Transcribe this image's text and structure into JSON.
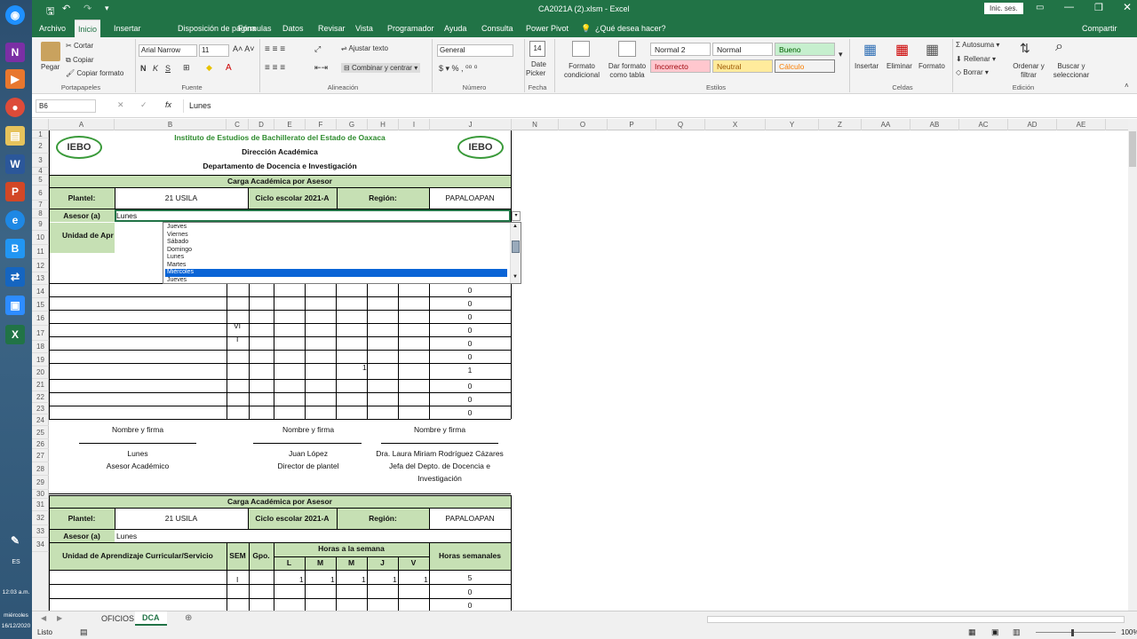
{
  "window": {
    "title": "CA2021A (2).xlsm  -  Excel",
    "signin": "Inic. ses.",
    "share": "Compartir"
  },
  "tabs": [
    "Archivo",
    "Inicio",
    "Insertar",
    "Disposición de página",
    "Fórmulas",
    "Datos",
    "Revisar",
    "Vista",
    "Programador",
    "Ayuda",
    "Consulta",
    "Power Pivot",
    "¿Qué desea hacer?"
  ],
  "ribbon": {
    "clipboard": {
      "paste": "Pegar",
      "cut": "Cortar",
      "copy": "Copiar",
      "format_painter": "Copiar formato",
      "label": "Portapapeles"
    },
    "font": {
      "name": "Arial Narrow",
      "size": "11",
      "label": "Fuente"
    },
    "alignment": {
      "wrap": "Ajustar texto",
      "merge": "Combinar y centrar",
      "label": "Alineación"
    },
    "number": {
      "format": "General",
      "label": "Número"
    },
    "date": {
      "btn1": "Date",
      "btn2": "Picker",
      "label": "Fecha"
    },
    "styles": {
      "cond": "Formato condicional",
      "table": "Dar formato como tabla",
      "normal2": "Normal 2",
      "normal": "Normal",
      "bueno": "Bueno",
      "incorrecto": "Incorrecto",
      "neutral": "Neutral",
      "calculo": "Cálculo",
      "label": "Estilos"
    },
    "cells": {
      "insert": "Insertar",
      "delete": "Eliminar",
      "format": "Formato",
      "label": "Celdas"
    },
    "editing": {
      "autosum": "Autosuma",
      "fill": "Rellenar",
      "clear": "Borrar",
      "sort": "Ordenar y filtrar",
      "find": "Buscar y seleccionar",
      "label": "Edición"
    }
  },
  "formula_bar": {
    "name_box": "B6",
    "content": "Lunes"
  },
  "columns": [
    "A",
    "B",
    "C",
    "D",
    "E",
    "F",
    "G",
    "H",
    "I",
    "J",
    "N",
    "O",
    "P",
    "Q",
    "X",
    "Y",
    "Z",
    "AA",
    "AB",
    "AC",
    "AD",
    "AE"
  ],
  "sheet": {
    "institute": "Instituto de Estudios de Bachillerato del Estado de Oaxaca",
    "direction": "Dirección Académica",
    "department": "Departamento de Docencia e Investigación",
    "logo": "IEBO",
    "section_title": "Carga Académica por Asesor",
    "plantel_label": "Plantel:",
    "plantel_value": "21 USILA",
    "ciclo": "Ciclo escolar 2021-A",
    "region_label": "Región:",
    "region_value": "PAPALOAPAN",
    "asesor_label": "Asesor (a)",
    "asesor_value": "Lunes",
    "unidad_partial": "Unidad de Apr",
    "unidad_label": "Unidad de Aprendizaje Curricular/Servicio",
    "sem": "SEM",
    "gpo": "Gpo.",
    "horas_semana": "Horas a la semana",
    "days": [
      "L",
      "M",
      "M",
      "J",
      "V"
    ],
    "horas_semanales": "Horas semanales",
    "j_values": [
      "0",
      "0",
      "0",
      "0",
      "0",
      "0",
      "1",
      "0",
      "0",
      "0"
    ],
    "c14": "VI",
    "c15": "I",
    "g17": "1",
    "sign1": {
      "label": "Nombre y firma",
      "name": "Lunes",
      "role": "Asesor Académico"
    },
    "sign2": {
      "label": "Nombre y firma",
      "name": "Juan López",
      "role": "Director de plantel"
    },
    "sign3": {
      "label": "Nombre y firma",
      "name": "Dra. Laura Miriam Rodríguez Cázares",
      "role1": "Jefa del Depto. de Docencia e",
      "role2": "Investigación"
    },
    "r32": {
      "sem": "I",
      "l": "1",
      "m": "1",
      "m2": "1",
      "j": "1",
      "v": "1",
      "total": "5"
    },
    "j33": "0",
    "j34": "0"
  },
  "dropdown": [
    "Jueves",
    "Viernes",
    "Sábado",
    "Domingo",
    "Lunes",
    "Martes",
    "Miércoles",
    "Jueves"
  ],
  "sheet_tabs": [
    "OFICIOS",
    "DCA"
  ],
  "status": {
    "ready": "Listo",
    "zoom": "100%"
  },
  "clock": {
    "time": "12:03 a.m.",
    "day": "miércoles",
    "date": "16/12/2020",
    "lang": "ES"
  }
}
